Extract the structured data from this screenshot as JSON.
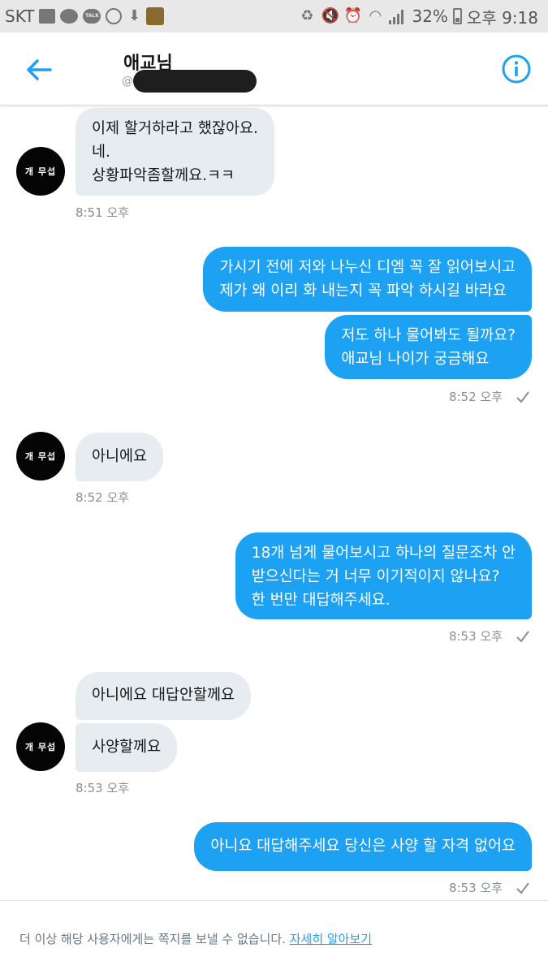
{
  "status_bar": {
    "carrier": "SKT",
    "talk_badge": "TALK",
    "battery": "32%",
    "time": "오후 9:18"
  },
  "header": {
    "name": "애교님",
    "handle_prefix": "@"
  },
  "avatar_label": "개 무섭",
  "messages": [
    {
      "lines": "이제 할거하라고 했잖아요.\n네.\n상황파악좀할께요.ㅋㅋ"
    },
    {
      "time": "8:51 오후"
    },
    {
      "lines": "가시기 전에 저와 나누신 디엠 꼭 잘 읽어보시고\n제가 왜 이리 화 내는지 꼭 파악 하시길 바라요"
    },
    {
      "lines": "저도 하나 물어봐도 될까요?\n애교님 나이가 궁금해요"
    },
    {
      "time": "8:52 오후"
    },
    {
      "lines": "아니에요"
    },
    {
      "time": "8:52 오후"
    },
    {
      "lines": "18개 넘게 물어보시고 하나의 질문조차 안\n받으신다는 거 너무 이기적이지 않나요?\n한 번만 대답해주세요."
    },
    {
      "time": "8:53 오후"
    },
    {
      "lines": "아니에요 대답안할께요"
    },
    {
      "lines": "사양할께요"
    },
    {
      "time": "8:53 오후"
    },
    {
      "lines": "아니요 대답해주세요 당신은 사양 할 자격 없어요"
    },
    {
      "time": "8:53 오후"
    }
  ],
  "footer": {
    "notice": "더 이상 해당 사용자에게는 쪽지를 보낼 수 없습니다. ",
    "link": "자세히 알아보기"
  },
  "colors": {
    "accent": "#1da1f2",
    "incoming_bubble": "#e6ecf0",
    "outgoing_text": "#ffffff"
  }
}
